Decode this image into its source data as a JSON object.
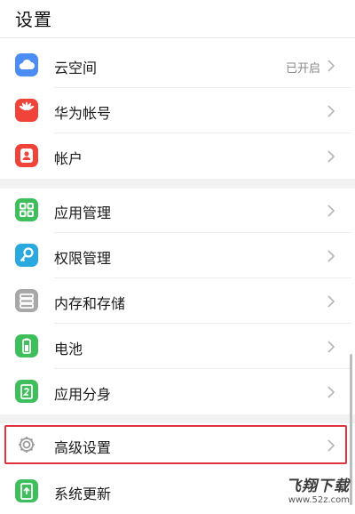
{
  "header": {
    "title": "设置"
  },
  "groups": [
    {
      "items": [
        {
          "key": "cloud",
          "label": "云空间",
          "status": "已开启",
          "icon": "cloud-icon",
          "color": "#4b8cf5"
        },
        {
          "key": "account",
          "label": "华为帐号",
          "status": "",
          "icon": "huawei-logo-icon",
          "color": "#f0443a"
        },
        {
          "key": "accounts",
          "label": "帐户",
          "status": "",
          "icon": "user-icon",
          "color": "#f0443a"
        }
      ]
    },
    {
      "items": [
        {
          "key": "apps",
          "label": "应用管理",
          "status": "",
          "icon": "grid-apps-icon",
          "color": "#3fbf5c"
        },
        {
          "key": "permissions",
          "label": "权限管理",
          "status": "",
          "icon": "key-icon",
          "color": "#2aa8e0"
        },
        {
          "key": "storage",
          "label": "内存和存储",
          "status": "",
          "icon": "storage-icon",
          "color": "#a8a8a8"
        },
        {
          "key": "battery",
          "label": "电池",
          "status": "",
          "icon": "battery-icon",
          "color": "#3fbf5c"
        },
        {
          "key": "twin",
          "label": "应用分身",
          "status": "",
          "icon": "app-twin-icon",
          "color": "#3fbf5c"
        }
      ]
    },
    {
      "items": [
        {
          "key": "advanced",
          "label": "高级设置",
          "status": "",
          "icon": "gear-icon",
          "color": "#9a9a9a",
          "highlighted": true
        },
        {
          "key": "update",
          "label": "系统更新",
          "status": "",
          "icon": "system-update-icon",
          "color": "#3fbf5c"
        }
      ]
    }
  ],
  "watermark": {
    "main": "飞翔下载",
    "sub": "www.52z.com"
  }
}
